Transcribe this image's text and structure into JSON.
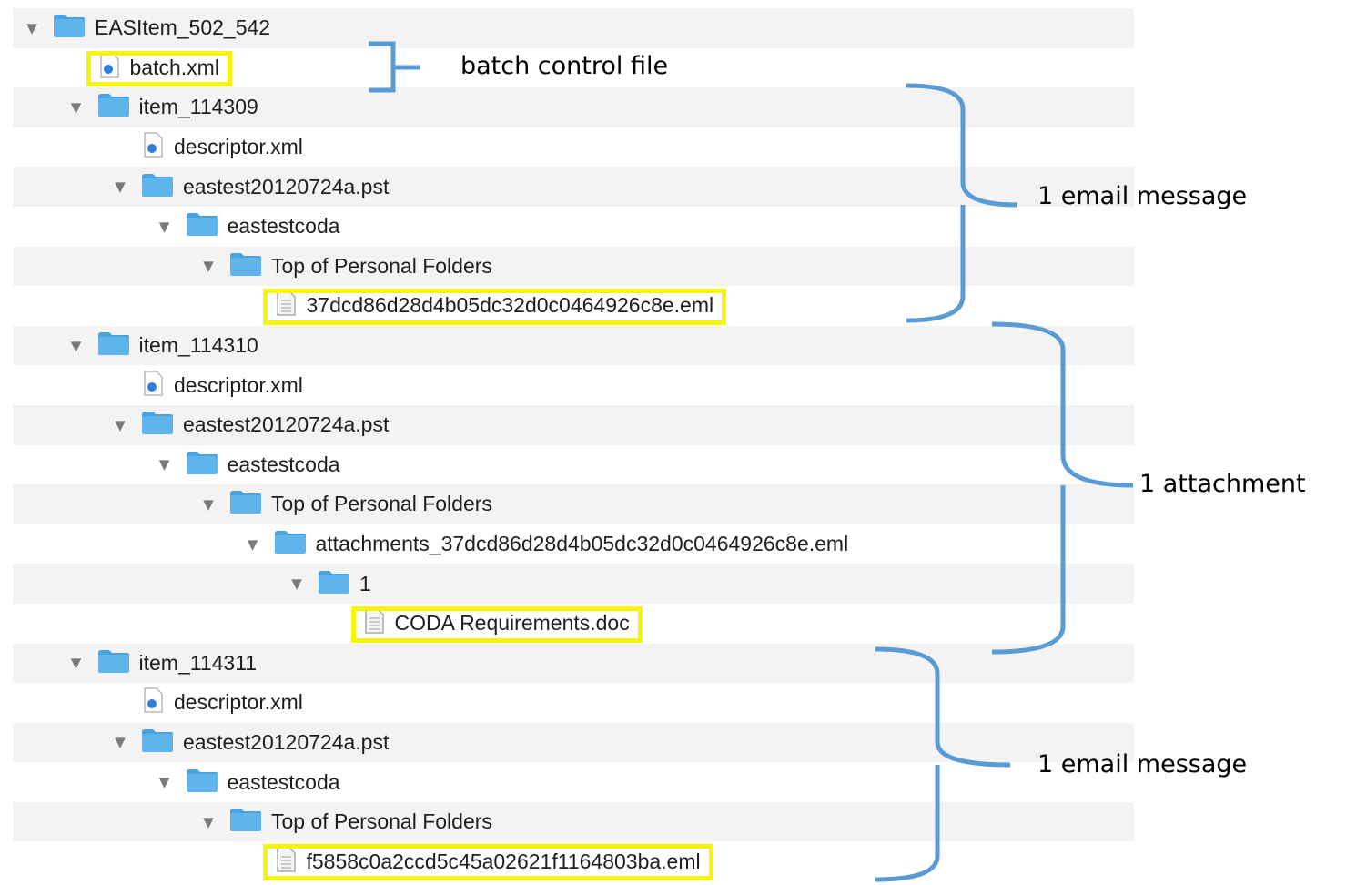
{
  "tree": {
    "rows": [
      {
        "depth": 0,
        "expanded": true,
        "icon": "folder-icon",
        "label": "EASItem_502_542"
      },
      {
        "depth": 1,
        "expanded": null,
        "icon": "xml-file-icon",
        "label": "batch.xml",
        "highlighted": true
      },
      {
        "depth": 1,
        "expanded": true,
        "icon": "folder-icon",
        "label": "item_114309"
      },
      {
        "depth": 2,
        "expanded": null,
        "icon": "xml-file-icon",
        "label": "descriptor.xml"
      },
      {
        "depth": 2,
        "expanded": true,
        "icon": "folder-icon",
        "label": "eastest20120724a.pst"
      },
      {
        "depth": 3,
        "expanded": true,
        "icon": "folder-icon",
        "label": "eastestcoda"
      },
      {
        "depth": 4,
        "expanded": true,
        "icon": "folder-icon",
        "label": "Top of Personal Folders"
      },
      {
        "depth": 5,
        "expanded": null,
        "icon": "document-icon",
        "label": "37dcd86d28d4b05dc32d0c0464926c8e.eml",
        "highlighted": true
      },
      {
        "depth": 1,
        "expanded": true,
        "icon": "folder-icon",
        "label": "item_114310"
      },
      {
        "depth": 2,
        "expanded": null,
        "icon": "xml-file-icon",
        "label": "descriptor.xml"
      },
      {
        "depth": 2,
        "expanded": true,
        "icon": "folder-icon",
        "label": "eastest20120724a.pst"
      },
      {
        "depth": 3,
        "expanded": true,
        "icon": "folder-icon",
        "label": "eastestcoda"
      },
      {
        "depth": 4,
        "expanded": true,
        "icon": "folder-icon",
        "label": "Top of Personal Folders"
      },
      {
        "depth": 5,
        "expanded": true,
        "icon": "folder-icon",
        "label": "attachments_37dcd86d28d4b05dc32d0c0464926c8e.eml"
      },
      {
        "depth": 6,
        "expanded": true,
        "icon": "folder-icon",
        "label": "1"
      },
      {
        "depth": 7,
        "expanded": null,
        "icon": "document-icon",
        "label": "CODA Requirements.doc",
        "highlighted": true
      },
      {
        "depth": 1,
        "expanded": true,
        "icon": "folder-icon",
        "label": "item_114311"
      },
      {
        "depth": 2,
        "expanded": null,
        "icon": "xml-file-icon",
        "label": "descriptor.xml"
      },
      {
        "depth": 2,
        "expanded": true,
        "icon": "folder-icon",
        "label": "eastest20120724a.pst"
      },
      {
        "depth": 3,
        "expanded": true,
        "icon": "folder-icon",
        "label": "eastestcoda"
      },
      {
        "depth": 4,
        "expanded": true,
        "icon": "folder-icon",
        "label": "Top of Personal Folders"
      },
      {
        "depth": 5,
        "expanded": null,
        "icon": "document-icon",
        "label": "f5858c0a2ccd5c45a02621f1164803ba.eml",
        "highlighted": true
      }
    ]
  },
  "annotations": [
    {
      "label": "batch control file"
    },
    {
      "label": "1 email  message"
    },
    {
      "label": "1 attachment"
    },
    {
      "label": "1 email  message"
    }
  ],
  "colors": {
    "folder": "#5fb4ea",
    "highlight": "#f5f50a",
    "bracket": "#5b9bd5",
    "row_alt": "#f3f3f3"
  }
}
